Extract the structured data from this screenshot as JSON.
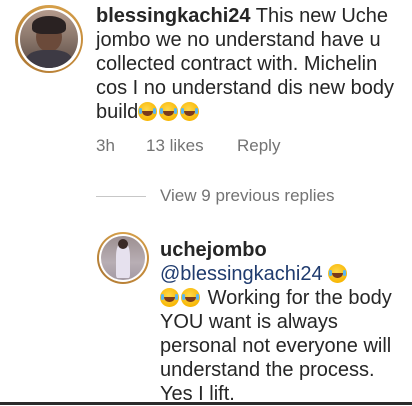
{
  "comment": {
    "username": "blessingkachi24",
    "text_before_emoji": " This new Uche jombo we no understand have u collected contract with. Michelin cos I no understand dis new body build",
    "emoji_count": 3,
    "emoji_icon": "face-with-tears-of-joy",
    "time": "3h",
    "likes": "13 likes",
    "reply_label": "Reply"
  },
  "view_replies_label": "View 9 previous replies",
  "reply": {
    "username": "uchejombo",
    "mention": "@blessingkachi24",
    "text": "Working for the body YOU want is always personal not everyone will understand the process. Yes I lift."
  },
  "colors": {
    "text": "#262626",
    "muted": "#737373",
    "mention": "#1f3b6e",
    "avatar_ring": "#c48a3a"
  }
}
